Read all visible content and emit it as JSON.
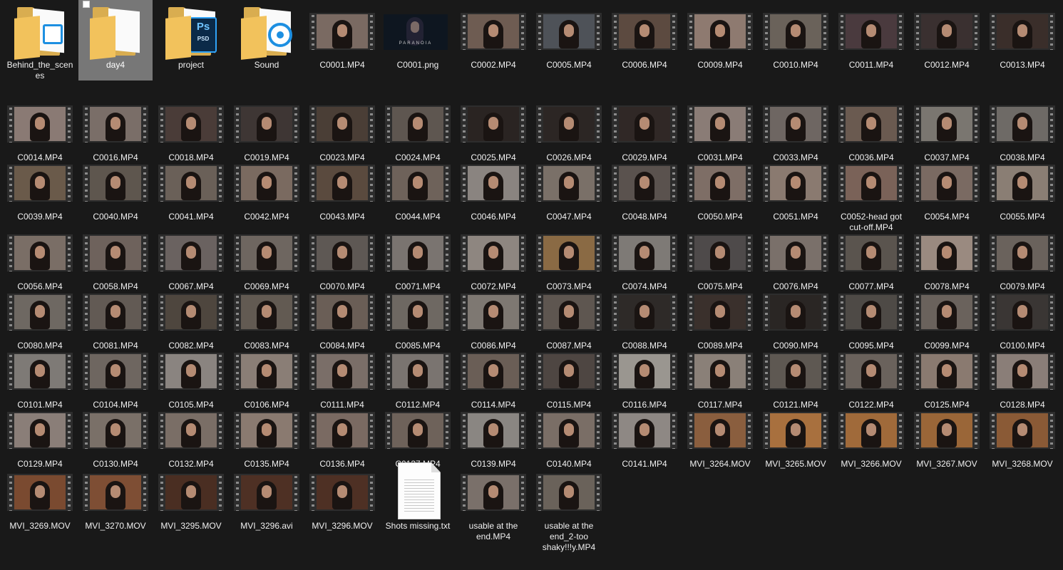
{
  "items": [
    {
      "label": "Behind_the_scenes",
      "kind": "folder",
      "badge": "doc"
    },
    {
      "label": "day4",
      "kind": "folder",
      "badge": "none",
      "selected": true
    },
    {
      "label": "project",
      "kind": "folder",
      "badge": "ps"
    },
    {
      "label": "Sound",
      "kind": "folder",
      "badge": "sound"
    },
    {
      "label": "C0001.MP4",
      "kind": "video",
      "tone": "#7a6a62"
    },
    {
      "label": "C0001.png",
      "kind": "image",
      "caption": "PARANOIA"
    },
    {
      "label": "C0002.MP4",
      "kind": "video",
      "tone": "#6e5c52"
    },
    {
      "label": "C0005.MP4",
      "kind": "video",
      "tone": "#4e5258"
    },
    {
      "label": "C0006.MP4",
      "kind": "video",
      "tone": "#5c4a40"
    },
    {
      "label": "C0009.MP4",
      "kind": "video",
      "tone": "#8e7a70"
    },
    {
      "label": "C0010.MP4",
      "kind": "video",
      "tone": "#6a625a"
    },
    {
      "label": "C0011.MP4",
      "kind": "video",
      "tone": "#4a3a3e"
    },
    {
      "label": "C0012.MP4",
      "kind": "video",
      "tone": "#3a3030"
    },
    {
      "label": "C0013.MP4",
      "kind": "video",
      "tone": "#3a2e2a"
    },
    {
      "label": "C0014.MP4",
      "kind": "video",
      "tone": "#8a7a74"
    },
    {
      "label": "C0016.MP4",
      "kind": "video",
      "tone": "#7a6e68"
    },
    {
      "label": "C0018.MP4",
      "kind": "video",
      "tone": "#4a3c38"
    },
    {
      "label": "C0019.MP4",
      "kind": "video",
      "tone": "#3e3634"
    },
    {
      "label": "C0023.MP4",
      "kind": "video",
      "tone": "#4a3e36"
    },
    {
      "label": "C0024.MP4",
      "kind": "video",
      "tone": "#5e5650"
    },
    {
      "label": "C0025.MP4",
      "kind": "video",
      "tone": "#2a2422"
    },
    {
      "label": "C0026.MP4",
      "kind": "video",
      "tone": "#2c2624"
    },
    {
      "label": "C0029.MP4",
      "kind": "video",
      "tone": "#302826"
    },
    {
      "label": "C0031.MP4",
      "kind": "video",
      "tone": "#8a7c76"
    },
    {
      "label": "C0033.MP4",
      "kind": "video",
      "tone": "#6e6662"
    },
    {
      "label": "C0036.MP4",
      "kind": "video",
      "tone": "#6a5a50"
    },
    {
      "label": "C0037.MP4",
      "kind": "video",
      "tone": "#7a7670"
    },
    {
      "label": "C0038.MP4",
      "kind": "video",
      "tone": "#6e6a66"
    },
    {
      "label": "C0039.MP4",
      "kind": "video",
      "tone": "#6a5a4a"
    },
    {
      "label": "C0040.MP4",
      "kind": "video",
      "tone": "#5e564e"
    },
    {
      "label": "C0041.MP4",
      "kind": "video",
      "tone": "#6a6058"
    },
    {
      "label": "C0042.MP4",
      "kind": "video",
      "tone": "#7a6a60"
    },
    {
      "label": "C0043.MP4",
      "kind": "video",
      "tone": "#5a4a3e"
    },
    {
      "label": "C0044.MP4",
      "kind": "video",
      "tone": "#6e625a"
    },
    {
      "label": "C0046.MP4",
      "kind": "video",
      "tone": "#8a8480"
    },
    {
      "label": "C0047.MP4",
      "kind": "video",
      "tone": "#7a7068"
    },
    {
      "label": "C0048.MP4",
      "kind": "video",
      "tone": "#5a524e"
    },
    {
      "label": "C0050.MP4",
      "kind": "video",
      "tone": "#7e6e66"
    },
    {
      "label": "C0051.MP4",
      "kind": "video",
      "tone": "#8a7a70"
    },
    {
      "label": "C0052-head got cut-off.MP4",
      "kind": "video",
      "tone": "#7a6258"
    },
    {
      "label": "C0054.MP4",
      "kind": "video",
      "tone": "#7a6a62"
    },
    {
      "label": "C0055.MP4",
      "kind": "video",
      "tone": "#8a7e74"
    },
    {
      "label": "C0056.MP4",
      "kind": "video",
      "tone": "#7a6e66"
    },
    {
      "label": "C0058.MP4",
      "kind": "video",
      "tone": "#6e625c"
    },
    {
      "label": "C0067.MP4",
      "kind": "video",
      "tone": "#6a6260"
    },
    {
      "label": "C0069.MP4",
      "kind": "video",
      "tone": "#6e6660"
    },
    {
      "label": "C0070.MP4",
      "kind": "video",
      "tone": "#5e5854"
    },
    {
      "label": "C0071.MP4",
      "kind": "video",
      "tone": "#7a7470"
    },
    {
      "label": "C0072.MP4",
      "kind": "video",
      "tone": "#8e8680"
    },
    {
      "label": "C0073.MP4",
      "kind": "video",
      "tone": "#8a6a44"
    },
    {
      "label": "C0074.MP4",
      "kind": "video",
      "tone": "#7e7a76"
    },
    {
      "label": "C0075.MP4",
      "kind": "video",
      "tone": "#4e4a4a"
    },
    {
      "label": "C0076.MP4",
      "kind": "video",
      "tone": "#7a706a"
    },
    {
      "label": "C0077.MP4",
      "kind": "video",
      "tone": "#5a544e"
    },
    {
      "label": "C0078.MP4",
      "kind": "video",
      "tone": "#9a8a80"
    },
    {
      "label": "C0079.MP4",
      "kind": "video",
      "tone": "#6a625c"
    },
    {
      "label": "C0080.MP4",
      "kind": "video",
      "tone": "#6e6862"
    },
    {
      "label": "C0081.MP4",
      "kind": "video",
      "tone": "#625a54"
    },
    {
      "label": "C0082.MP4",
      "kind": "video",
      "tone": "#4e463e"
    },
    {
      "label": "C0083.MP4",
      "kind": "video",
      "tone": "#625a52"
    },
    {
      "label": "C0084.MP4",
      "kind": "video",
      "tone": "#6a5e56"
    },
    {
      "label": "C0085.MP4",
      "kind": "video",
      "tone": "#6e6862"
    },
    {
      "label": "C0086.MP4",
      "kind": "video",
      "tone": "#7e7872"
    },
    {
      "label": "C0087.MP4",
      "kind": "video",
      "tone": "#5e5650"
    },
    {
      "label": "C0088.MP4",
      "kind": "video",
      "tone": "#2e2a28"
    },
    {
      "label": "C0089.MP4",
      "kind": "video",
      "tone": "#3a302c"
    },
    {
      "label": "C0090.MP4",
      "kind": "video",
      "tone": "#2a2624"
    },
    {
      "label": "C0095.MP4",
      "kind": "video",
      "tone": "#4e4a46"
    },
    {
      "label": "C0099.MP4",
      "kind": "video",
      "tone": "#6a625c"
    },
    {
      "label": "C0100.MP4",
      "kind": "video",
      "tone": "#3a3634"
    },
    {
      "label": "C0101.MP4",
      "kind": "video",
      "tone": "#7e7a76"
    },
    {
      "label": "C0104.MP4",
      "kind": "video",
      "tone": "#6e6660"
    },
    {
      "label": "C0105.MP4",
      "kind": "video",
      "tone": "#8a8480"
    },
    {
      "label": "C0106.MP4",
      "kind": "video",
      "tone": "#8a7e76"
    },
    {
      "label": "C0111.MP4",
      "kind": "video",
      "tone": "#7a6e68"
    },
    {
      "label": "C0112.MP4",
      "kind": "video",
      "tone": "#7a7470"
    },
    {
      "label": "C0114.MP4",
      "kind": "video",
      "tone": "#6a5e56"
    },
    {
      "label": "C0115.MP4",
      "kind": "video",
      "tone": "#4e4642"
    },
    {
      "label": "C0116.MP4",
      "kind": "video",
      "tone": "#9a9690"
    },
    {
      "label": "C0117.MP4",
      "kind": "video",
      "tone": "#8a8078"
    },
    {
      "label": "C0121.MP4",
      "kind": "video",
      "tone": "#5e5852"
    },
    {
      "label": "C0122.MP4",
      "kind": "video",
      "tone": "#6a625c"
    },
    {
      "label": "C0125.MP4",
      "kind": "video",
      "tone": "#8a7a70"
    },
    {
      "label": "C0128.MP4",
      "kind": "video",
      "tone": "#8a7e78"
    },
    {
      "label": "C0129.MP4",
      "kind": "video",
      "tone": "#8a7e78"
    },
    {
      "label": "C0130.MP4",
      "kind": "video",
      "tone": "#7a7068"
    },
    {
      "label": "C0132.MP4",
      "kind": "video",
      "tone": "#7a6e66"
    },
    {
      "label": "C0135.MP4",
      "kind": "video",
      "tone": "#8a7a70"
    },
    {
      "label": "C0136.MP4",
      "kind": "video",
      "tone": "#7a6a62"
    },
    {
      "label": "C0137.MP4",
      "kind": "video",
      "tone": "#6e625a"
    },
    {
      "label": "C0139.MP4",
      "kind": "video",
      "tone": "#8a8682"
    },
    {
      "label": "C0140.MP4",
      "kind": "video",
      "tone": "#7a6e66"
    },
    {
      "label": "C0141.MP4",
      "kind": "video",
      "tone": "#8e8884"
    },
    {
      "label": "MVI_3264.MOV",
      "kind": "video",
      "tone": "#8a5e3e"
    },
    {
      "label": "MVI_3265.MOV",
      "kind": "video",
      "tone": "#a8703e"
    },
    {
      "label": "MVI_3266.MOV",
      "kind": "video",
      "tone": "#a06a3a"
    },
    {
      "label": "MVI_3267.MOV",
      "kind": "video",
      "tone": "#9a6638"
    },
    {
      "label": "MVI_3268.MOV",
      "kind": "video",
      "tone": "#8a5a36"
    },
    {
      "label": "MVI_3269.MOV",
      "kind": "video",
      "tone": "#7a4a30"
    },
    {
      "label": "MVI_3270.MOV",
      "kind": "video",
      "tone": "#7e4e34"
    },
    {
      "label": "MVI_3295.MOV",
      "kind": "video",
      "tone": "#4a2e22"
    },
    {
      "label": "MVI_3296.avi",
      "kind": "video",
      "tone": "#4e3024"
    },
    {
      "label": "MVI_3296.MOV",
      "kind": "video",
      "tone": "#4e3024"
    },
    {
      "label": "Shots missing.txt",
      "kind": "text"
    },
    {
      "label": "usable at the end.MP4",
      "kind": "video",
      "tone": "#7a706a"
    },
    {
      "label": "usable at the end_2-too shaky!!!y.MP4",
      "kind": "video",
      "tone": "#6a625a"
    }
  ]
}
